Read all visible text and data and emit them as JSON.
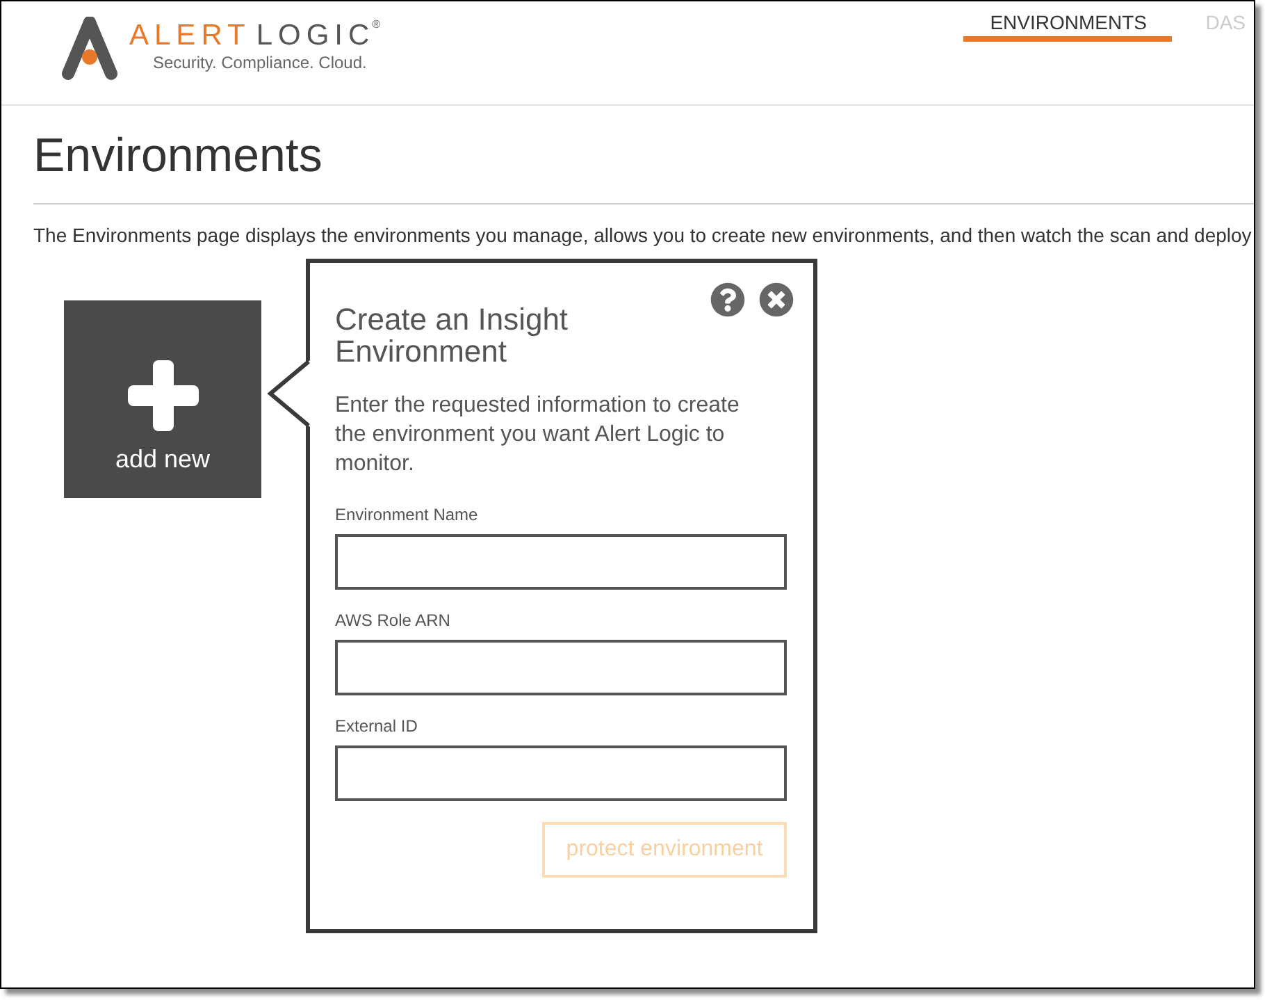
{
  "header": {
    "logo": {
      "name_accent": "ALERT",
      "name_rest": "LOGIC",
      "registered_mark": "®",
      "tagline": "Security. Compliance. Cloud."
    },
    "nav_tabs": [
      {
        "label": "ENVIRONMENTS",
        "selected": true
      },
      {
        "label": "DAS",
        "selected": false
      }
    ]
  },
  "page": {
    "title": "Environments",
    "description": "The Environments page displays the environments you manage, allows you to create new environments, and then watch the scan and deploy"
  },
  "add_tile": {
    "label": "add new"
  },
  "create_panel": {
    "title": "Create an Insight Environment",
    "intro": "Enter the requested information to create the environment you want Alert Logic to monitor.",
    "fields": [
      {
        "label": "Environment Name"
      },
      {
        "label": "AWS Role ARN"
      },
      {
        "label": "External ID"
      }
    ],
    "submit": {
      "label": "protect environment",
      "disabled": true
    }
  }
}
